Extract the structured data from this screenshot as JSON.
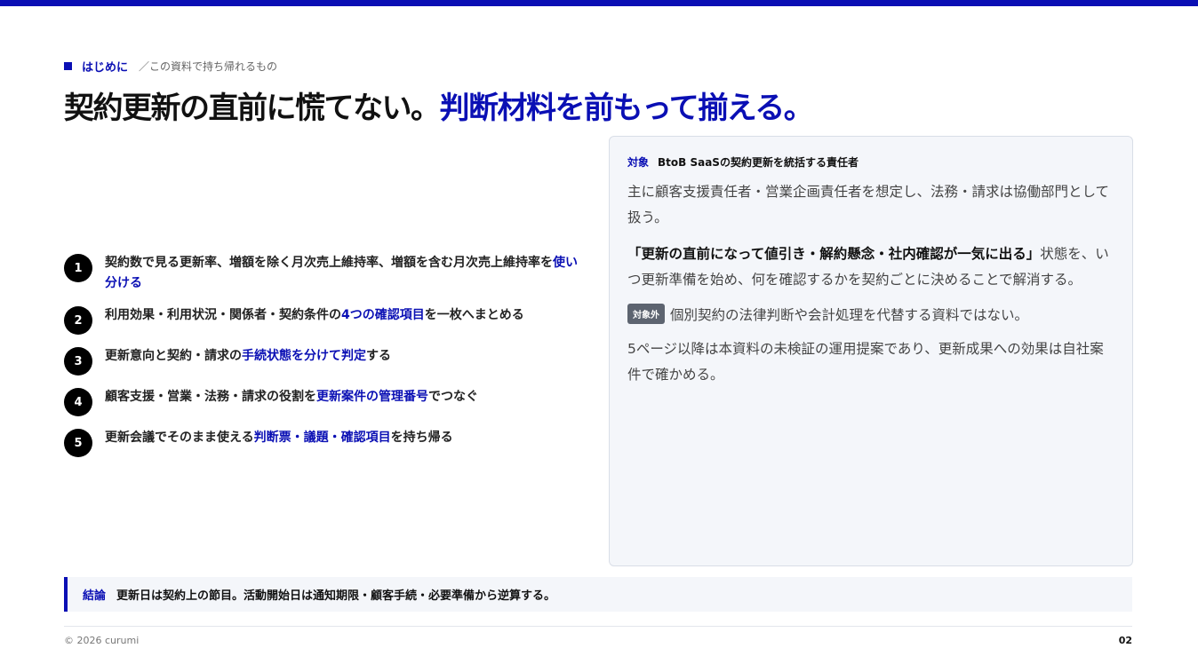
{
  "section": {
    "name": "はじめに",
    "subtitle": "／この資料で持ち帰れるもの"
  },
  "headline": {
    "main": "契約更新の直前に慌てない。",
    "accent": "判断材料を前もって揃える。"
  },
  "points": [
    {
      "num": "1",
      "pre": "契約数で見る更新率、増額を除く月次売上維持率、増額を含む月次売上維持率を",
      "hl": "使い分ける",
      "post": ""
    },
    {
      "num": "2",
      "pre": "利用効果・利用状況・関係者・契約条件の",
      "hl": "4つの確認項目",
      "post": "を一枚へまとめる"
    },
    {
      "num": "3",
      "pre": "更新意向と契約・請求の",
      "hl": "手続状態を分けて判定",
      "post": "する"
    },
    {
      "num": "4",
      "pre": "顧客支援・営業・法務・請求の役割を",
      "hl": "更新案件の管理番号",
      "post": "でつなぐ"
    },
    {
      "num": "5",
      "pre": "更新会議でそのまま使える",
      "hl": "判断票・議題・確認項目",
      "post": "を持ち帰る"
    }
  ],
  "panel": {
    "target_tag": "対象",
    "target_text": "BtoB SaaSの契約更新を統括する責任者",
    "p1": "主に顧客支援責任者・営業企画責任者を想定し、法務・請求は協働部門として扱う。",
    "p2_strong": "「更新の直前になって値引き・解約懸念・社内確認が一気に出る」",
    "p2_rest": "状態を、いつ更新準備を始め、何を確認するかを契約ごとに決めることで解消する。",
    "exclusion_badge": "対象外",
    "exclusion_text": "個別契約の法律判断や会計処理を代替する資料ではない。",
    "p3": "5ページ以降は本資料の未検証の運用提案であり、更新成果への効果は自社案件で確かめる。"
  },
  "conclusion": {
    "tag": "結論",
    "text": "更新日は契約上の節目。活動開始日は通知期限・顧客手続・必要準備から逆算する。"
  },
  "footer": {
    "copyright": "© 2026 curumi",
    "page": "02"
  },
  "colors": {
    "accent": "#0a0fb4",
    "panel_bg": "#f4f6fa",
    "badge_bg": "#5d6470"
  }
}
